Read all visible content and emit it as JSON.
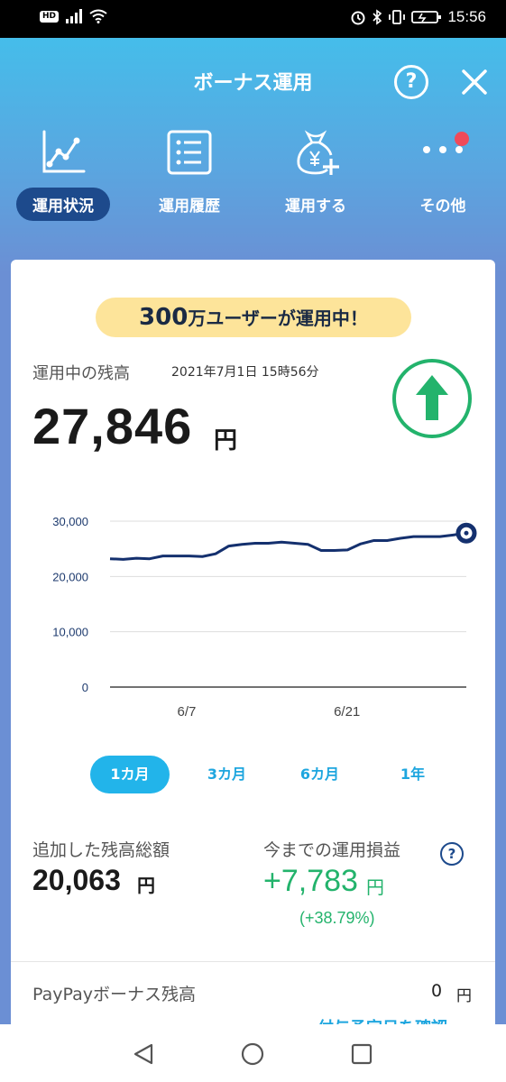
{
  "status_bar": {
    "badge": "HD",
    "time": "15:56"
  },
  "header": {
    "title": "ボーナス運用",
    "help_symbol": "?",
    "nav": [
      {
        "label": "運用状況",
        "icon": "chart-line-icon",
        "active": true
      },
      {
        "label": "運用履歴",
        "icon": "list-icon",
        "active": false
      },
      {
        "label": "運用する",
        "icon": "money-bag-add-icon",
        "active": false
      },
      {
        "label": "その他",
        "icon": "more-dots-icon",
        "active": false,
        "notification": true
      }
    ]
  },
  "banner": {
    "num": "300",
    "text": "万ユーザーが運用中！"
  },
  "balance": {
    "label": "運用中の残高",
    "timestamp": "2021年7月1日 15時56分",
    "value": "27,846",
    "unit": "円",
    "trend": "up"
  },
  "chart_data": {
    "type": "line",
    "y_ticks": [
      "30,000",
      "20,000",
      "10,000",
      "0"
    ],
    "x_ticks": [
      "6/7",
      "6/21"
    ],
    "ylim": [
      0,
      30000
    ],
    "series": [
      {
        "values": [
          23200,
          23100,
          23300,
          23200,
          23700,
          23700,
          23700,
          23600,
          24100,
          25500,
          25800,
          26000,
          26000,
          26200,
          26000,
          25800,
          24700,
          24700,
          24800,
          25900,
          26500,
          26500,
          26900,
          27200,
          27200,
          27200,
          27500,
          27846
        ]
      }
    ],
    "line_color": "#14306e",
    "grid": true
  },
  "periods": [
    {
      "label": "1カ月",
      "active": true
    },
    {
      "label": "3カ月",
      "active": false
    },
    {
      "label": "6カ月",
      "active": false
    },
    {
      "label": "1年",
      "active": false
    }
  ],
  "stats": {
    "added_label": "追加した残高総額",
    "added_value": "20,063",
    "added_unit": "円",
    "profit_label": "今までの運用損益",
    "profit_value": "+7,783",
    "profit_unit": "円",
    "profit_pct": "(+38.79%)",
    "help_symbol": "?"
  },
  "paypay": {
    "label": "PayPayボーナス残高",
    "value": "0",
    "unit": "円",
    "link": "付与予定日を確認"
  },
  "colors": {
    "accent": "#22b4ea",
    "navy": "#1d4a8c",
    "positive": "#23b36c",
    "banner": "#fde49a"
  }
}
